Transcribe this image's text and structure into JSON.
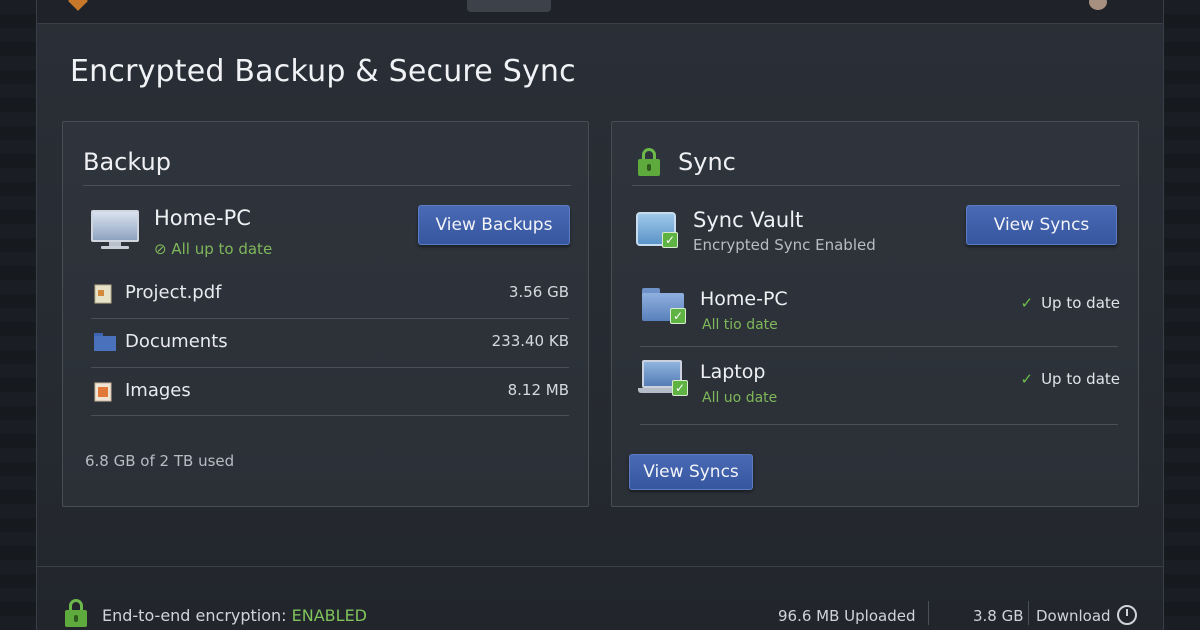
{
  "page_title": "Encrypted Backup & Secure Sync",
  "backup": {
    "title": "Backup",
    "device": {
      "name": "Home-PC",
      "status": "All up to date",
      "icon": "monitor-icon"
    },
    "view_button": "View Backups",
    "files": [
      {
        "name": "Project.pdf",
        "size": "3.56 GB",
        "icon": "pdf-file-icon"
      },
      {
        "name": "Documents",
        "size": "233.40 KB",
        "icon": "folder-icon"
      },
      {
        "name": "Images",
        "size": "8.12 MB",
        "icon": "image-file-icon"
      }
    ],
    "usage": "6.8 GB of 2 TB used"
  },
  "sync": {
    "title": "Sync",
    "vault": {
      "name": "Sync Vault",
      "subtitle": "Encrypted Sync Enabled",
      "icon": "sync-vault-icon"
    },
    "view_button_top": "View Syncs",
    "devices": [
      {
        "name": "Home-PC",
        "sub": "All tio date",
        "status": "Up to date",
        "icon": "folder-icon"
      },
      {
        "name": "Laptop",
        "sub": "All uo date",
        "status": "Up to date",
        "icon": "laptop-icon"
      }
    ],
    "view_button_bottom": "View Syncs"
  },
  "footer": {
    "encryption_label": "End-to-end encryption:",
    "encryption_value": "ENABLED",
    "uploaded": "96.6 MB Uploaded",
    "download_size": "3.8 GB",
    "download_label": "Download"
  },
  "colors": {
    "accent_blue": "#3656a0",
    "success_green": "#7fb75a",
    "background": "#2a2f37"
  }
}
